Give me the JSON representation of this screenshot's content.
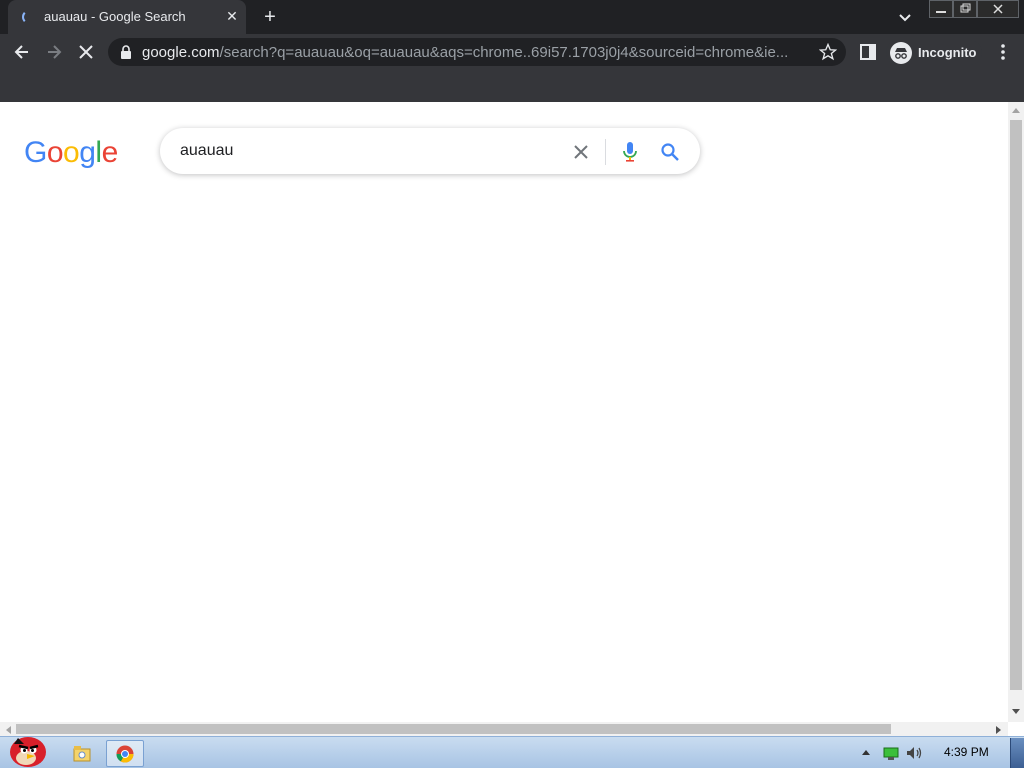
{
  "browser": {
    "tab_title": "auauau - Google Search",
    "url_host": "google.com",
    "url_rest": "/search?q=auauau&oq=auauau&aqs=chrome..69i57.1703j0j4&sourceid=chrome&ie...",
    "incognito_label": "Incognito"
  },
  "page": {
    "logo": {
      "G": "G",
      "o1": "o",
      "o2": "o",
      "g": "g",
      "l": "l",
      "e": "e"
    },
    "search_query": "auauau"
  },
  "taskbar": {
    "clock": "4:39 PM"
  },
  "colors": {
    "blue": "#4285F4",
    "red": "#EA4335",
    "yellow": "#FBBC05",
    "green": "#34A853"
  }
}
